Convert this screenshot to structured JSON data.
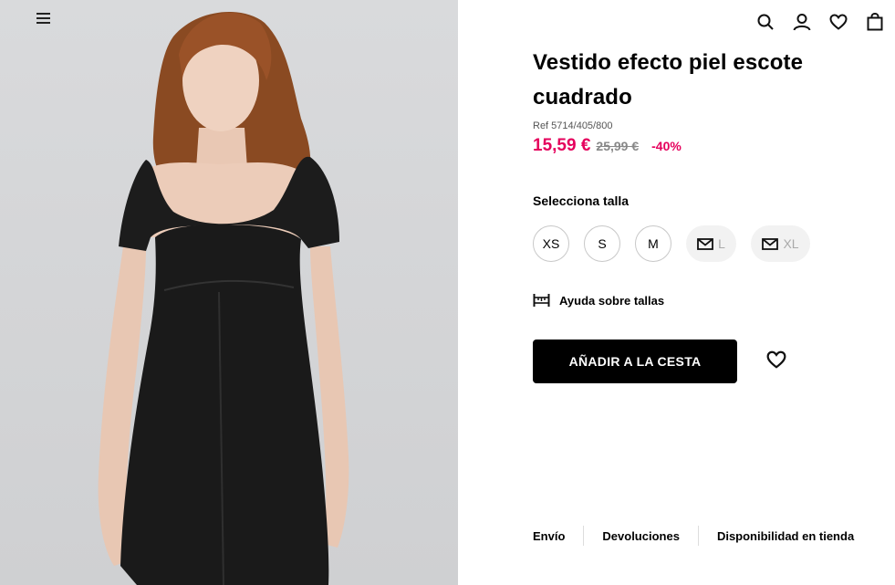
{
  "product": {
    "title": "Vestido efecto piel escote cuadrado",
    "ref": "Ref 5714/405/800",
    "price_now": "15,59 €",
    "price_old": "25,99 €",
    "discount": "-40%"
  },
  "sizes": {
    "label": "Selecciona talla",
    "options": [
      "XS",
      "S",
      "M",
      "L",
      "XL"
    ],
    "out_of_stock": [
      "L",
      "XL"
    ]
  },
  "help": {
    "label": "Ayuda sobre tallas"
  },
  "cart": {
    "add_label": "AÑADIR A LA CESTA"
  },
  "footer_tabs": [
    "Envío",
    "Devoluciones",
    "Disponibilidad en tienda"
  ],
  "colors": {
    "accent": "#e5005c",
    "button": "#000000"
  }
}
